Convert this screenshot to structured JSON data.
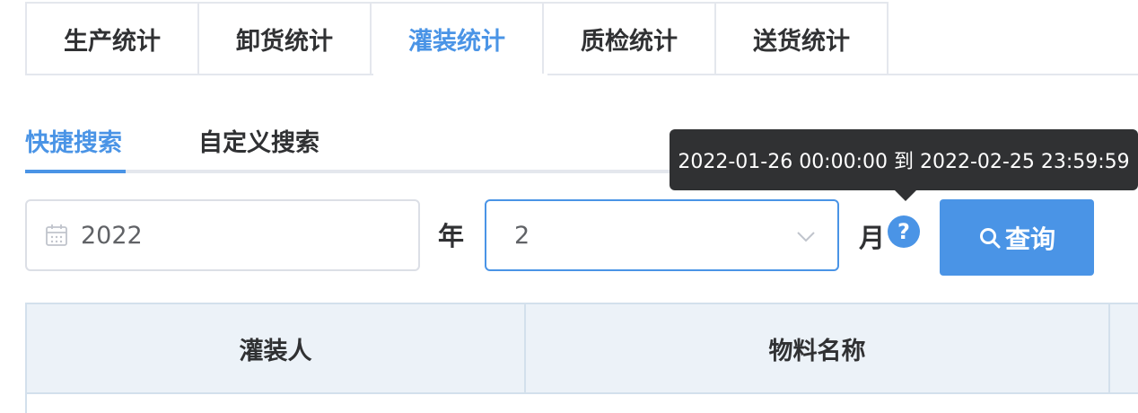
{
  "top_tabs": [
    {
      "label": "生产统计",
      "active": false
    },
    {
      "label": "卸货统计",
      "active": false
    },
    {
      "label": "灌装统计",
      "active": true
    },
    {
      "label": "质检统计",
      "active": false
    },
    {
      "label": "送货统计",
      "active": false
    }
  ],
  "sub_tabs": [
    {
      "label": "快捷搜索",
      "active": true
    },
    {
      "label": "自定义搜索",
      "active": false
    }
  ],
  "search": {
    "year_value": "2022",
    "year_label": "年",
    "month_value": "2",
    "month_label": "月",
    "help_icon_text": "?",
    "query_label": "查询"
  },
  "tooltip": {
    "text": "2022-01-26 00:00:00 到 2022-02-25 23:59:59"
  },
  "table": {
    "columns": [
      "灌装人",
      "物料名称",
      ""
    ]
  },
  "icons": {
    "calendar": "calendar-icon",
    "chevron": "chevron-down-icon",
    "help": "help-icon",
    "search": "search-icon"
  },
  "colors": {
    "accent": "#4a94e6",
    "text": "#303133",
    "tooltip_bg": "#303133",
    "table_header_bg": "#ecf2f8"
  }
}
